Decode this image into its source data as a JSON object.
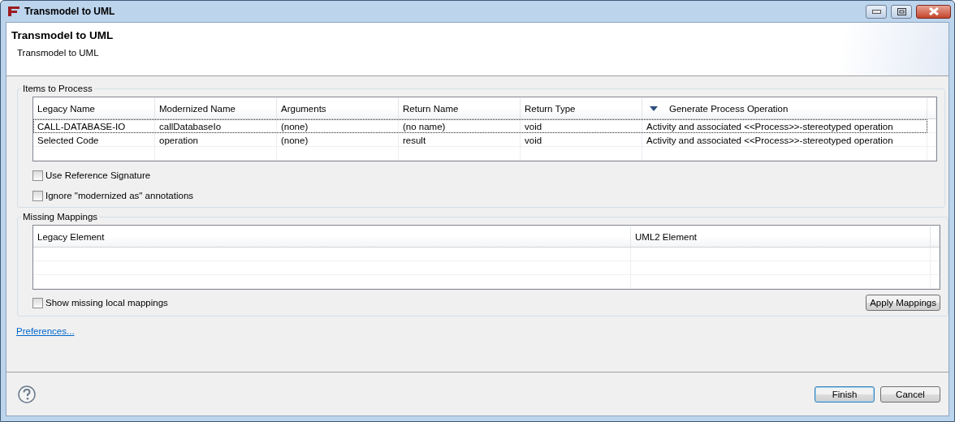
{
  "window": {
    "title": "Transmodel to UML"
  },
  "header": {
    "title": "Transmodel to UML",
    "description": "Transmodel to UML"
  },
  "items_group": {
    "label": "Items to Process",
    "table": {
      "columns": [
        {
          "label": "Legacy Name",
          "sorted": false
        },
        {
          "label": "Modernized Name",
          "sorted": false
        },
        {
          "label": "Arguments",
          "sorted": false
        },
        {
          "label": "Return Name",
          "sorted": false
        },
        {
          "label": "Return Type",
          "sorted": false
        },
        {
          "label": "Generate Process Operation",
          "sorted": true
        }
      ],
      "rows": [
        {
          "focused": true,
          "cells": [
            "CALL-DATABASE-IO",
            "callDatabaseIo",
            "(none)",
            "(no name)",
            "void",
            "Activity and associated <<Process>>-stereotyped operation"
          ]
        },
        {
          "focused": false,
          "cells": [
            "Selected Code",
            "operation",
            "(none)",
            "result",
            "void",
            "Activity and associated <<Process>>-stereotyped operation"
          ]
        }
      ]
    },
    "checkboxes": [
      {
        "label": "Use Reference Signature",
        "checked": false
      },
      {
        "label": "Ignore \"modernized as\" annotations",
        "checked": false
      }
    ]
  },
  "mappings_group": {
    "label": "Missing Mappings",
    "table": {
      "columns": [
        {
          "label": "Legacy Element",
          "sorted": false
        },
        {
          "label": "UML2 Element",
          "sorted": false
        }
      ]
    },
    "checkbox": {
      "label": "Show missing local mappings",
      "checked": false
    },
    "button": "Apply Mappings"
  },
  "preferences_link": "Preferences...",
  "buttons": [
    {
      "label": "Finish",
      "default": true
    },
    {
      "label": "Cancel",
      "default": false
    }
  ]
}
